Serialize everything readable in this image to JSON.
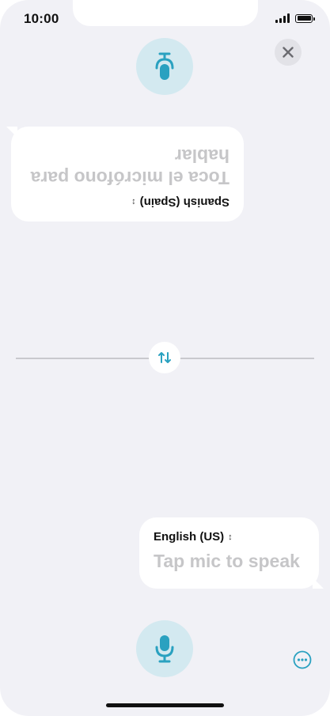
{
  "status_bar": {
    "time": "10:00",
    "icons": [
      "cellular-signal-icon",
      "battery-icon"
    ]
  },
  "colors": {
    "background": "#f1f1f6",
    "accent": "#2aa1c0",
    "mic_button_bg": "#d3e9f0",
    "placeholder": "#c6c6c8"
  },
  "top_panel": {
    "language": "Spanish (Spain)",
    "placeholder": "Toca el micrófono para hablar",
    "mic_icon": "microphone-icon",
    "orientation": "upside-down"
  },
  "bottom_panel": {
    "language": "English (US)",
    "placeholder": "Tap mic to speak",
    "mic_icon": "microphone-icon"
  },
  "controls": {
    "close_icon": "close-icon",
    "swap_icon": "swap-arrows-icon",
    "more_icon": "more-options-icon"
  }
}
